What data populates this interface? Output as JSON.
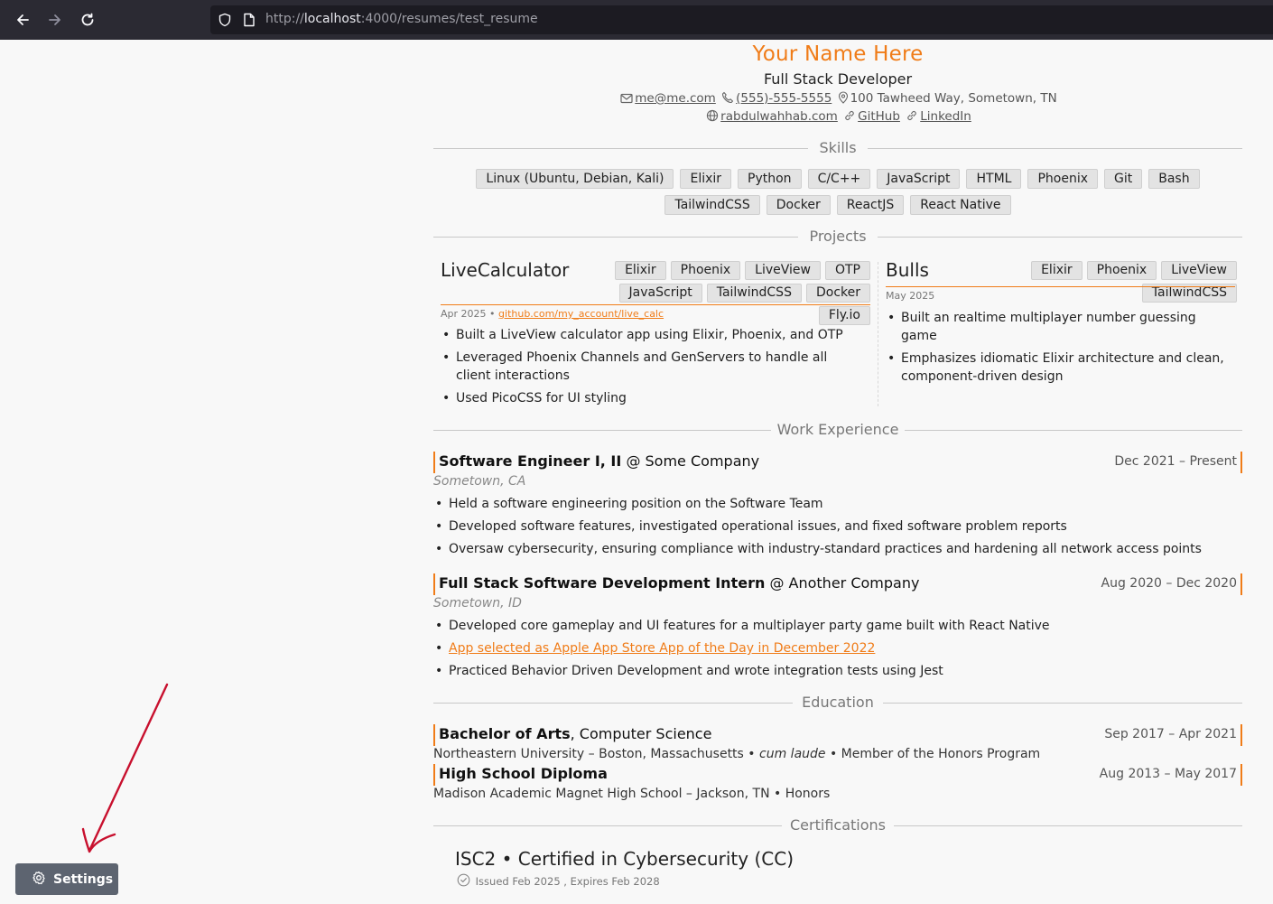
{
  "browser": {
    "url_prefix": "http://",
    "url_host": "localhost",
    "url_path": ":4000/resumes/test_resume"
  },
  "resume": {
    "name": "Your Name Here",
    "headline": "Full Stack Developer",
    "email": "me@me.com",
    "phone": "(555)-555-5555",
    "address": "100 Tawheed Way, Sometown, TN",
    "website": "rabdulwahhab.com",
    "github": "GitHub",
    "linkedin": "LinkedIn"
  },
  "sections": {
    "skills": "Skills",
    "projects": "Projects",
    "work": "Work Experience",
    "education": "Education",
    "certifications": "Certifications"
  },
  "skills": [
    "Linux (Ubuntu, Debian, Kali)",
    "Elixir",
    "Python",
    "C/C++",
    "JavaScript",
    "HTML",
    "Phoenix",
    "Git",
    "Bash",
    "TailwindCSS",
    "Docker",
    "ReactJS",
    "React Native"
  ],
  "projects": [
    {
      "title": "LiveCalculator",
      "tags": [
        "Elixir",
        "Phoenix",
        "LiveView",
        "OTP",
        "JavaScript",
        "TailwindCSS",
        "Docker",
        "Fly.io"
      ],
      "date": "Apr 2025",
      "sep": "•",
      "link": "github.com/my_account/live_calc",
      "bullets": [
        "Built a LiveView calculator app using Elixir, Phoenix, and OTP",
        "Leveraged Phoenix Channels and GenServers to handle all client interactions",
        "Used PicoCSS for UI styling"
      ]
    },
    {
      "title": "Bulls",
      "tags": [
        "Elixir",
        "Phoenix",
        "LiveView",
        "TailwindCSS"
      ],
      "date": "May 2025",
      "bullets": [
        "Built an realtime multiplayer number guessing game",
        "Emphasizes idiomatic Elixir architecture and clean, component-driven design"
      ]
    }
  ],
  "jobs": [
    {
      "role": "Software Engineer I, II",
      "company": "@ Some Company",
      "dates": "Dec 2021 – Present",
      "location": "Sometown, CA",
      "bullets": [
        "Held a software engineering position on the Software Team",
        "Developed software features, investigated operational issues, and fixed software problem reports",
        "Oversaw cybersecurity, ensuring compliance with industry-standard practices and hardening all network access points"
      ]
    },
    {
      "role": "Full Stack Software Development Intern",
      "company": "@ Another Company",
      "dates": "Aug 2020 – Dec 2020",
      "location": "Sometown, ID",
      "bullets": [
        "Developed core gameplay and UI features for a multiplayer party game built with React Native",
        "App selected as Apple App Store App of the Day in December 2022",
        "Practiced Behavior Driven Development and wrote integration tests using Jest"
      ]
    }
  ],
  "education": [
    {
      "degree": "Bachelor of Arts",
      "field": ", Computer Science",
      "dates": "Sep 2017 – Apr 2021",
      "school": "Northeastern University – Boston, Massachusetts •",
      "honor_italic": "cum laude",
      "extra": "• Member of the Honors Program"
    },
    {
      "degree": "High School Diploma",
      "dates": "Aug 2013 – May 2017",
      "school": "Madison Academic Magnet High School – Jackson, TN • Honors"
    }
  ],
  "certification": {
    "title": "ISC2 • Certified in Cybersecurity (CC)",
    "issued": "Issued Feb 2025 , Expires Feb 2028"
  },
  "settings": {
    "label": "Settings"
  },
  "colors": {
    "accent": "#f07c18",
    "toolbar": "#2b2a33",
    "annotation_arrow": "#c8102e"
  }
}
